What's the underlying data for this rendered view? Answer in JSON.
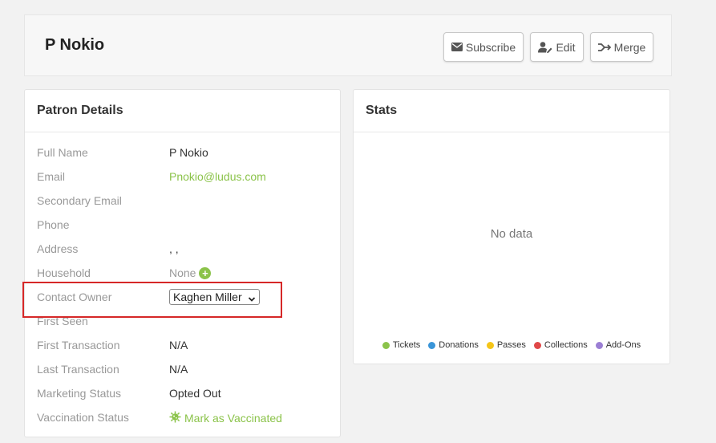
{
  "header": {
    "patron_name": "P Nokio"
  },
  "actions": {
    "subscribe_label": "Subscribe",
    "edit_label": "Edit",
    "merge_label": "Merge"
  },
  "details": {
    "title": "Patron Details",
    "rows": [
      {
        "label": "Full Name",
        "value": "P Nokio"
      },
      {
        "label": "Email",
        "value": "Pnokio@ludus.com"
      },
      {
        "label": "Secondary Email",
        "value": ""
      },
      {
        "label": "Phone",
        "value": ""
      },
      {
        "label": "Address",
        "value": ", ,"
      },
      {
        "label": "Household",
        "value": "None"
      },
      {
        "label": "Contact Owner",
        "value": "Kaghen Miller"
      },
      {
        "label": "First Seen",
        "value": ""
      },
      {
        "label": "First Transaction",
        "value": "N/A"
      },
      {
        "label": "Last Transaction",
        "value": "N/A"
      },
      {
        "label": "Marketing Status",
        "value": "Opted Out"
      },
      {
        "label": "Vaccination Status",
        "value": "Mark as Vaccinated"
      }
    ]
  },
  "stats": {
    "title": "Stats",
    "empty_text": "No data",
    "legend": [
      {
        "name": "Tickets",
        "color": "#8bc34a"
      },
      {
        "name": "Donations",
        "color": "#3a95d8"
      },
      {
        "name": "Passes",
        "color": "#f5c518"
      },
      {
        "name": "Collections",
        "color": "#e04848"
      },
      {
        "name": "Add-Ons",
        "color": "#9b7fd4"
      }
    ]
  },
  "icons": {
    "subscribe": "envelope-icon",
    "edit": "user-edit-icon",
    "merge": "merge-arrow-icon",
    "household_add": "plus-circle-icon",
    "vaccination": "virus-icon",
    "select": "chevron-down-icon"
  },
  "colors": {
    "accent": "#8bc34a",
    "highlight": "#d62828"
  }
}
